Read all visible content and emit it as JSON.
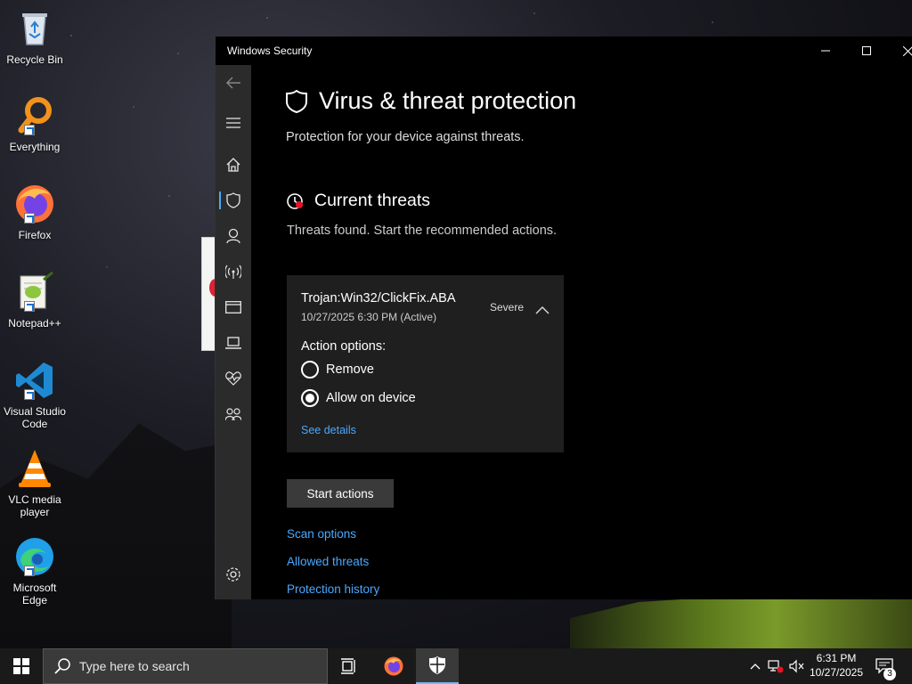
{
  "desktop": {
    "icons": [
      {
        "label": "Recycle Bin",
        "icon": "recycle-bin-icon"
      },
      {
        "label": "Everything",
        "icon": "everything-search-icon"
      },
      {
        "label": "Firefox",
        "icon": "firefox-icon"
      },
      {
        "label": "Notepad++",
        "icon": "notepad-plus-plus-icon"
      },
      {
        "label": "Visual Studio Code",
        "icon": "vscode-icon"
      },
      {
        "label": "VLC media player",
        "icon": "vlc-icon"
      },
      {
        "label": "Microsoft Edge",
        "icon": "edge-icon"
      }
    ]
  },
  "window": {
    "title": "Windows Security",
    "controls": [
      "minimize",
      "maximize",
      "close"
    ]
  },
  "nav": {
    "items": [
      {
        "icon": "back-arrow-icon"
      },
      {
        "icon": "hamburger-menu-icon"
      },
      {
        "icon": "home-icon"
      },
      {
        "icon": "shield-icon",
        "active": true
      },
      {
        "icon": "account-icon"
      },
      {
        "icon": "network-icon"
      },
      {
        "icon": "app-browser-icon"
      },
      {
        "icon": "device-security-icon"
      },
      {
        "icon": "health-icon"
      },
      {
        "icon": "family-icon"
      },
      {
        "icon": "settings-gear-icon"
      }
    ]
  },
  "page": {
    "title": "Virus & threat protection",
    "subtitle": "Protection for your device against threats.",
    "section_title": "Current threats",
    "section_desc": "Threats found. Start the recommended actions."
  },
  "threat": {
    "name": "Trojan:Win32/ClickFix.ABA",
    "date": "10/27/2025 6:30 PM (Active)",
    "severity": "Severe",
    "action_label": "Action options:",
    "options": [
      {
        "label": "Remove",
        "checked": false
      },
      {
        "label": "Allow on device",
        "checked": true
      }
    ],
    "see_details": "See details"
  },
  "actions": {
    "start_button": "Start actions",
    "links": [
      "Scan options",
      "Allowed threats",
      "Protection history"
    ]
  },
  "taskbar": {
    "search_placeholder": "Type here to search",
    "time": "6:31 PM",
    "date": "10/27/2025",
    "notification_count": "3"
  },
  "colors": {
    "accent": "#4aa8ff",
    "window_bg": "#000000",
    "nav_bg": "#2b2b2b",
    "card_bg": "#1f1f1f"
  }
}
